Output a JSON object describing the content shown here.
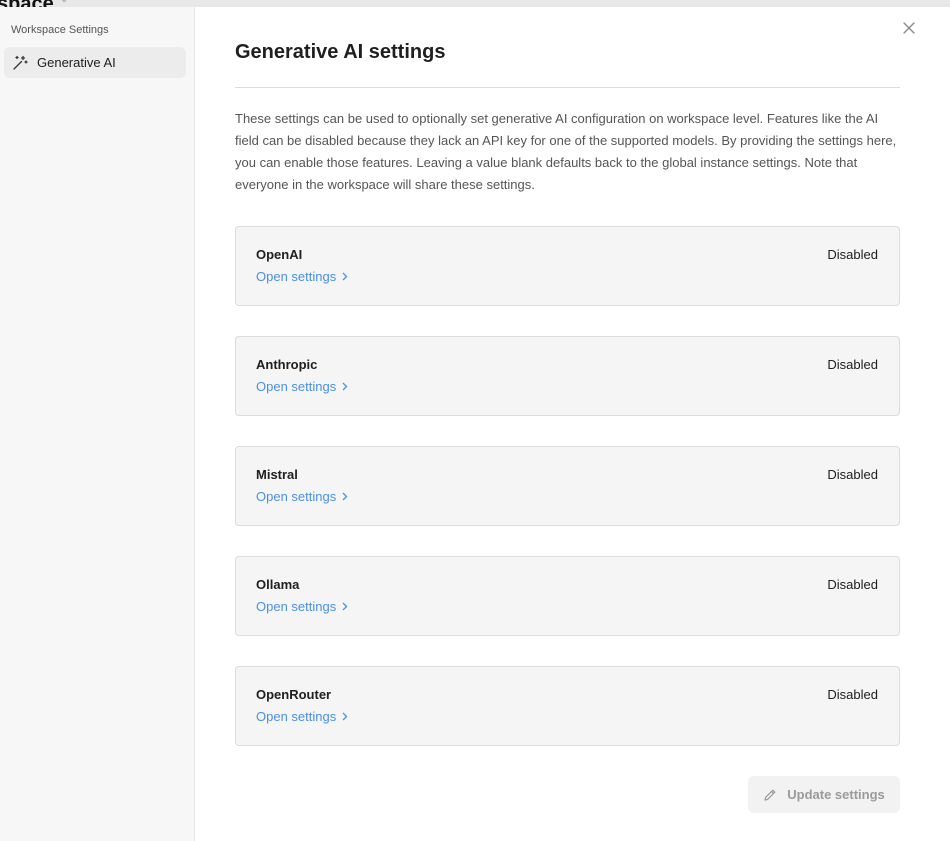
{
  "background": {
    "title_fragment": "space"
  },
  "sidebar": {
    "heading": "Workspace Settings",
    "items": [
      {
        "label": "Generative AI",
        "icon": "magic-wand-icon",
        "active": true
      }
    ]
  },
  "main": {
    "title": "Generative AI settings",
    "description": "These settings can be used to optionally set generative AI configuration on workspace level. Features like the AI field can be disabled because they lack an API key for one of the supported models. By providing the settings here, you can enable those features. Leaving a value blank defaults back to the global instance settings. Note that everyone in the workspace will share these settings.",
    "providers": [
      {
        "name": "OpenAI",
        "status": "Disabled",
        "link": "Open settings"
      },
      {
        "name": "Anthropic",
        "status": "Disabled",
        "link": "Open settings"
      },
      {
        "name": "Mistral",
        "status": "Disabled",
        "link": "Open settings"
      },
      {
        "name": "Ollama",
        "status": "Disabled",
        "link": "Open settings"
      },
      {
        "name": "OpenRouter",
        "status": "Disabled",
        "link": "Open settings"
      }
    ],
    "update_button": {
      "label": "Update settings",
      "icon": "pencil-icon",
      "disabled": true
    }
  },
  "colors": {
    "link": "#4a90e2",
    "sidebar_bg": "#f7f7f7",
    "card_bg": "#f5f5f5"
  }
}
